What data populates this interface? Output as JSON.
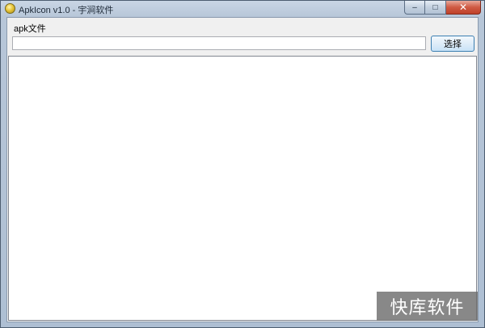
{
  "window": {
    "title": "ApkIcon v1.0 - 宇涧软件",
    "app_icon": "app-logo-icon"
  },
  "caption_buttons": {
    "minimize_glyph": "–",
    "maximize_glyph": "□",
    "close_glyph": "✕"
  },
  "form": {
    "apk_label": "apk文件",
    "path_value": "",
    "path_placeholder": "",
    "select_label": "选择"
  },
  "output": {
    "content": ""
  },
  "watermark": {
    "text": "快库软件"
  },
  "colors": {
    "titlebar": "#b7c6d8",
    "close_button": "#c9472f",
    "select_button_border": "#3c7fb1",
    "watermark_bg": "#6e6e6e"
  }
}
